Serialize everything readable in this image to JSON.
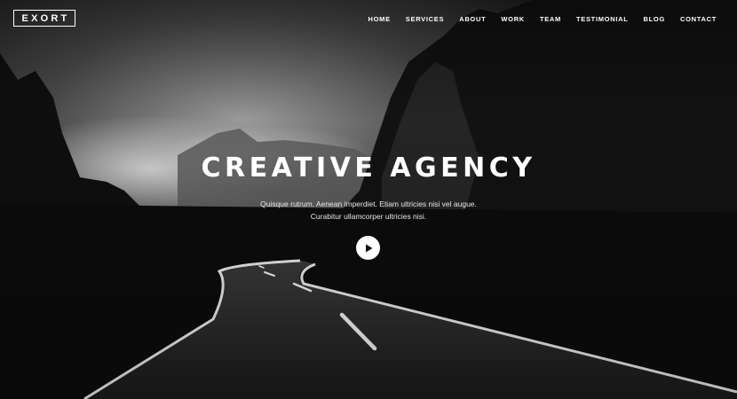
{
  "brand": {
    "logo": "EXORT"
  },
  "nav": {
    "items": [
      "HOME",
      "SERVICES",
      "ABOUT",
      "WORK",
      "TEAM",
      "TESTIMONIAL",
      "BLOG",
      "CONTACT"
    ]
  },
  "hero": {
    "headline": "CREATIVE AGENCY",
    "subtext_line1": "Quisque rutrum. Aenean imperdiet. Etiam ultricies nisi vel augue.",
    "subtext_line2": "Curabitur ullamcorper ultricies nisi.",
    "play_icon": "play-icon"
  },
  "colors": {
    "text": "#ffffff",
    "background": "#0a0a0a",
    "road_line": "#ffffff"
  }
}
